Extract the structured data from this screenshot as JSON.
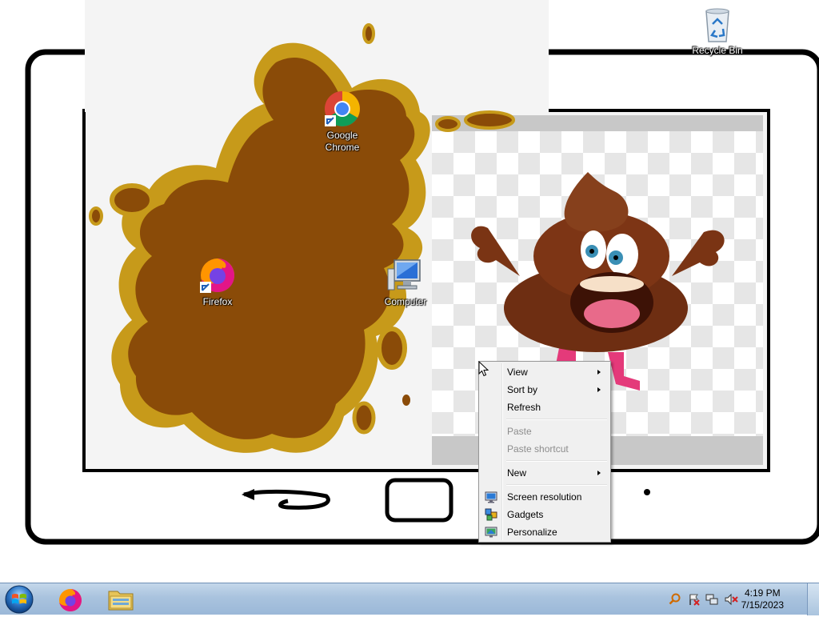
{
  "desktop": {
    "icons": {
      "recycle_bin": "Recycle Bin",
      "chrome_line1": "Google",
      "chrome_line2": "Chrome",
      "firefox": "Firefox",
      "computer": "Computer"
    }
  },
  "context_menu": {
    "view": "View",
    "sort_by": "Sort by",
    "refresh": "Refresh",
    "paste": "Paste",
    "paste_shortcut": "Paste shortcut",
    "new": "New",
    "screen_resolution": "Screen resolution",
    "gadgets": "Gadgets",
    "personalize": "Personalize"
  },
  "taskbar": {
    "pinned": [
      "firefox-icon",
      "windows-explorer-icon"
    ],
    "clock": {
      "time": "4:19 PM",
      "date": "7/15/2023"
    }
  },
  "colors": {
    "taskbar": "#a9c3de",
    "menu_bg": "#f0f0f0",
    "splat_brown": "#8a4b08",
    "splat_gold": "#c79a1a"
  }
}
